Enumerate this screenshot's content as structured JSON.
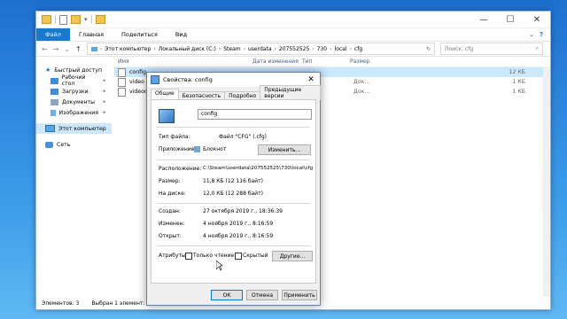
{
  "explorer": {
    "ribbon_tabs": [
      "Файл",
      "Главная",
      "Поделиться",
      "Вид"
    ],
    "breadcrumb": [
      "Этот компьютер",
      "Локальный диск (C:)",
      "Steam",
      "userdata",
      "207552525",
      "730",
      "local",
      "cfg"
    ],
    "search_placeholder": "Поиск: cfg",
    "sidebar": {
      "quick_access": "Быстрый доступ",
      "items": [
        "Рабочий стол",
        "Загрузки",
        "Документы",
        "Изображения"
      ],
      "this_pc": "Этот компьютер",
      "network": "Сеть"
    },
    "columns": {
      "name": "Имя",
      "date": "Дата изменения",
      "type": "Тип",
      "size": "Размер"
    },
    "files": [
      {
        "name": "config",
        "type": "",
        "size": "12 КБ"
      },
      {
        "name": "video",
        "type": "Док...",
        "size": "1 КБ"
      },
      {
        "name": "videodef",
        "type": "Док...",
        "size": "1 КБ"
      }
    ],
    "status": {
      "items": "Элементов: 3",
      "selected": "Выбран 1 элемент: 11,8 КБ"
    }
  },
  "dialog": {
    "title": "Свойства: config",
    "tabs": [
      "Общие",
      "Безопасность",
      "Подробно",
      "Предыдущие версии"
    ],
    "file_name": "config",
    "labels": {
      "type": "Тип файла:",
      "app": "Приложение:",
      "location": "Расположение:",
      "size": "Размер:",
      "disk": "На диске:",
      "created": "Создан:",
      "modified": "Изменен:",
      "opened": "Открыт:",
      "attributes": "Атрибуты:"
    },
    "values": {
      "type": "Файл \"CFG\" (.cfg)",
      "app": "Блокнот",
      "location": "C:\\Steam\\userdata\\207552525\\730\\local\\cfg",
      "size": "11,8 КБ (12 116 байт)",
      "disk": "12,0 КБ (12 288 байт)",
      "created": "27 октября 2019 г., 18:36:39",
      "modified": "4 ноября 2019 г., 8:16:59",
      "opened": "4 ноября 2019 г., 8:16:59"
    },
    "buttons": {
      "change": "Изменить...",
      "other": "Другие...",
      "ok": "ОК",
      "cancel": "Отмена",
      "apply": "Применить"
    },
    "checkboxes": {
      "readonly": "Только чтение",
      "hidden": "Скрытый"
    }
  }
}
